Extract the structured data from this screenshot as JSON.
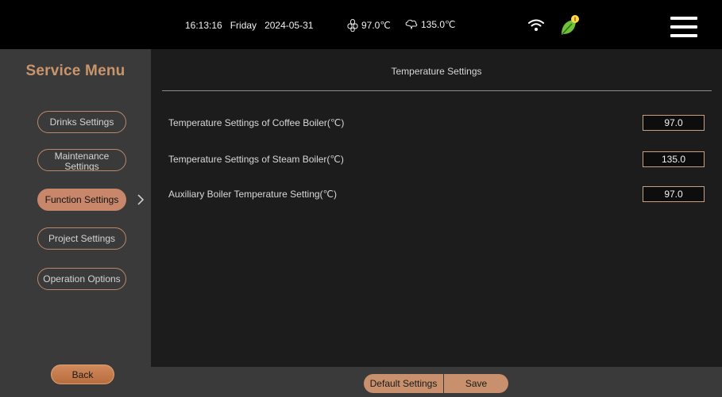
{
  "status_bar": {
    "time": "16:13:16",
    "day": "Friday",
    "date": "2024-05-31",
    "coffee_temp": "97.0℃",
    "steam_temp": "135.0℃",
    "leaf_badge_color": "#ffd84a",
    "leaf_color": "#6fc23a"
  },
  "sidebar": {
    "title": "Service Menu",
    "items": [
      {
        "label": "Drinks Settings",
        "active": false
      },
      {
        "label": "Maintenance Settings",
        "active": false
      },
      {
        "label": "Function Settings",
        "active": true
      },
      {
        "label": "Project Settings",
        "active": false
      },
      {
        "label": "Operation Options",
        "active": false
      }
    ],
    "back_label": "Back"
  },
  "main": {
    "title": "Temperature Settings",
    "settings": [
      {
        "label": "Temperature Settings of Coffee Boiler(℃)",
        "value": "97.0"
      },
      {
        "label": "Temperature Settings of Steam Boiler(℃)",
        "value": "135.0"
      },
      {
        "label": "Auxiliary Boiler Temperature Setting(℃)",
        "value": "97.0"
      }
    ]
  },
  "footer": {
    "default_label": "Default Settings",
    "save_label": "Save"
  },
  "colors": {
    "accent": "#c8866a",
    "sidebar_bg": "#3a3a3a",
    "main_bg": "#1c1c1c",
    "title_color": "#c8956c"
  }
}
